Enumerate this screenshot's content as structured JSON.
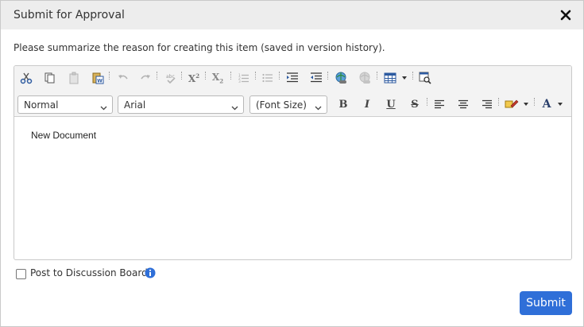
{
  "dialog": {
    "title": "Submit for Approval",
    "prompt": "Please summarize the reason for creating this item (saved in version history).",
    "close_icon": "close-icon"
  },
  "toolbar": {
    "row1_icons": [
      "cut-icon",
      "copy-icon",
      "paste-icon",
      "paste-from-word-icon",
      "undo-icon",
      "redo-icon",
      "spellcheck-icon",
      "superscript-icon",
      "subscript-icon",
      "numbered-list-icon",
      "bulleted-list-icon",
      "outdent-icon",
      "indent-icon",
      "insert-link-icon",
      "remove-link-icon",
      "insert-table-icon",
      "find-icon"
    ],
    "superscript_label": "X",
    "superscript_mark": "2",
    "subscript_label": "X",
    "subscript_mark": "2",
    "paragraph_format": "Normal",
    "font_family": "Arial",
    "font_size": "(Font Size)",
    "bold_label": "B",
    "italic_label": "I",
    "underline_label": "U",
    "strike_label": "S",
    "font_color_label": "A"
  },
  "editor": {
    "content": "New Document"
  },
  "options": {
    "post_to_board_label": "Post to Discussion Board",
    "post_to_board_checked": false
  },
  "actions": {
    "submit_label": "Submit"
  },
  "colors": {
    "accent": "#2f6fd8",
    "titlebar": "#ededed",
    "toolbar": "#f3f3f3",
    "info_icon": "#2f6fd8"
  }
}
